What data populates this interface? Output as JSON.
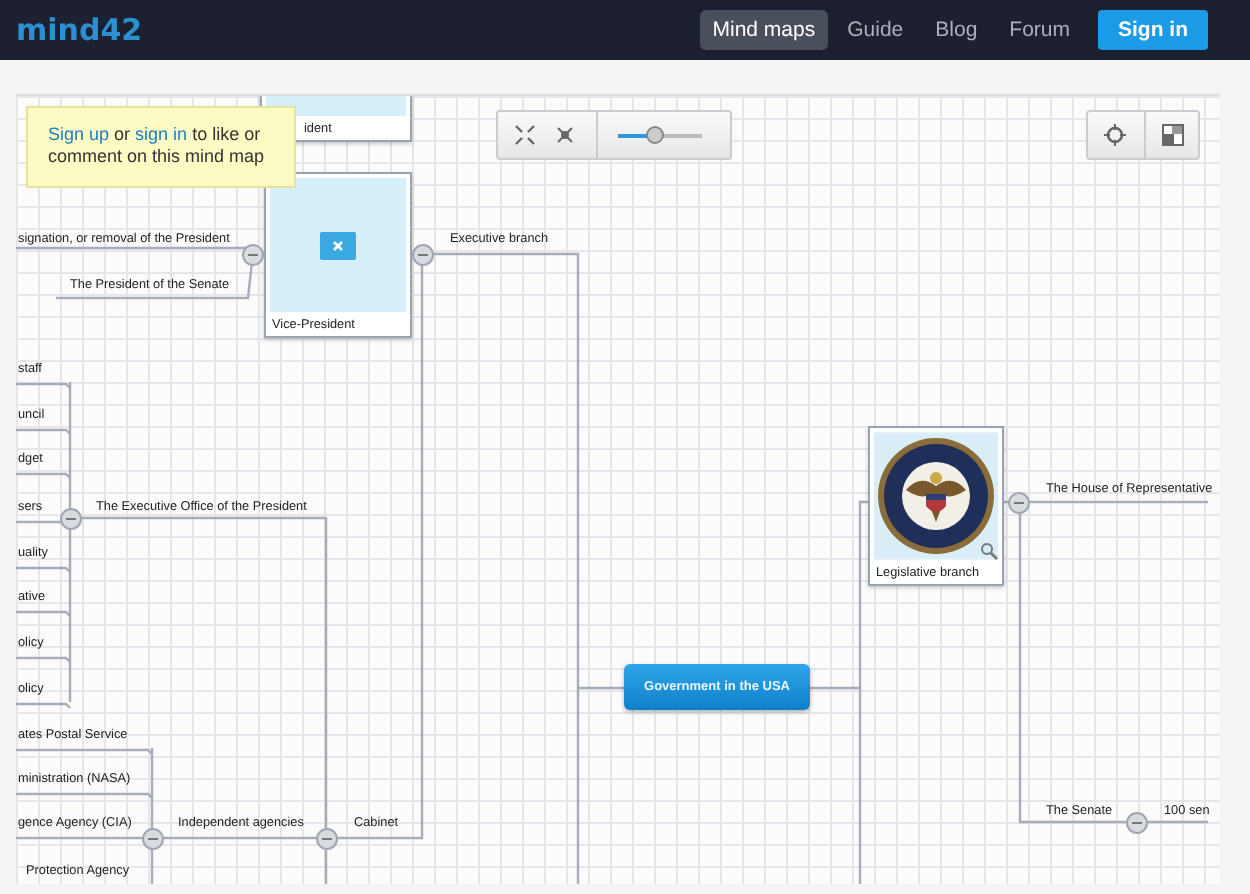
{
  "header": {
    "logo": "mind42",
    "nav": [
      {
        "label": "Mind maps",
        "selected": true
      },
      {
        "label": "Guide",
        "selected": false
      },
      {
        "label": "Blog",
        "selected": false
      },
      {
        "label": "Forum",
        "selected": false
      }
    ],
    "sign_in": "Sign in"
  },
  "tooltip": {
    "parts": [
      {
        "kind": "link",
        "text": "Sign up"
      },
      {
        "kind": "text",
        "text": " or "
      },
      {
        "kind": "link",
        "text": "sign in"
      },
      {
        "kind": "text",
        "text": " to like or comment on this mind map"
      }
    ]
  },
  "zoom": {
    "level": 0.45
  },
  "nodes": [
    {
      "kind": "card_top",
      "text": "ident"
    },
    {
      "kind": "label",
      "text": "signation, or removal of the President"
    },
    {
      "kind": "label",
      "text": "The President of the Senate"
    },
    {
      "kind": "card_placeholder",
      "text": "Vice-President"
    },
    {
      "kind": "label",
      "text": "Executive branch"
    },
    {
      "kind": "label",
      "text": "staff"
    },
    {
      "kind": "label",
      "text": "uncil"
    },
    {
      "kind": "label",
      "text": "dget"
    },
    {
      "kind": "label",
      "text": "sers"
    },
    {
      "kind": "label",
      "text": "uality"
    },
    {
      "kind": "label",
      "text": "ative"
    },
    {
      "kind": "label",
      "text": "olicy"
    },
    {
      "kind": "label",
      "text": "olicy"
    },
    {
      "kind": "label",
      "text": "The Executive Office of the President"
    },
    {
      "kind": "label",
      "text": "ates Postal Service"
    },
    {
      "kind": "label",
      "text": "ministration (NASA)"
    },
    {
      "kind": "label",
      "text": "gence Agency (CIA)"
    },
    {
      "kind": "label",
      "text": "Protection Agency"
    },
    {
      "kind": "label",
      "text": "Independent agencies"
    },
    {
      "kind": "label",
      "text": "Cabinet"
    },
    {
      "kind": "root",
      "text": "Government in the USA"
    },
    {
      "kind": "card_picture",
      "text": "Legislative branch"
    },
    {
      "kind": "label",
      "text": "The House of Representative"
    },
    {
      "kind": "label",
      "text": "The Senate"
    },
    {
      "kind": "label",
      "text": "100 sen"
    }
  ]
}
